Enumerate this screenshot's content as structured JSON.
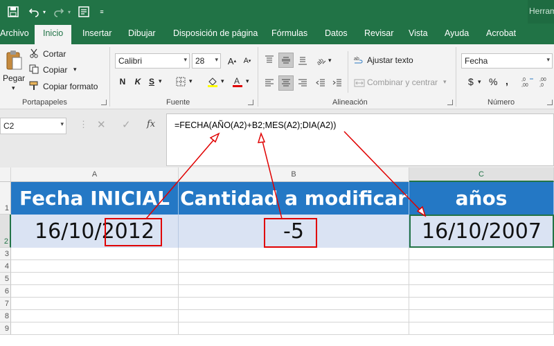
{
  "titlebar": {
    "app_title": "Herramientas"
  },
  "tabs": [
    "Archivo",
    "Inicio",
    "Insertar",
    "Dibujar",
    "Disposición de página",
    "Fórmulas",
    "Datos",
    "Revisar",
    "Vista",
    "Ayuda",
    "Acrobat"
  ],
  "ribbon": {
    "clipboard": {
      "paste_label": "Pegar",
      "cut_label": "Cortar",
      "copy_label": "Copiar",
      "format_painter_label": "Copiar formato",
      "group_label": "Portapapeles"
    },
    "font": {
      "font_name": "Calibri",
      "font_size": "28",
      "bold": "N",
      "italic": "K",
      "underline": "S",
      "group_label": "Fuente"
    },
    "alignment": {
      "wrap_label": "Ajustar texto",
      "merge_label": "Combinar y centrar",
      "group_label": "Alineación"
    },
    "number": {
      "format_value": "Fecha",
      "currency": "$",
      "percent": "%",
      "group_label": "Número"
    }
  },
  "formula_bar": {
    "name_box": "C2",
    "fx": "fx",
    "formula": "=FECHA(AÑO(A2)+B2;MES(A2);DIA(A2))"
  },
  "sheet": {
    "columns": [
      "A",
      "B",
      "C"
    ],
    "rows": [
      "1",
      "2",
      "3",
      "4",
      "5",
      "6",
      "7",
      "8",
      "9"
    ],
    "headers": [
      "Fecha INICIAL",
      "Cantidad a modificar",
      "años"
    ],
    "values": [
      "16/10/2012",
      "-5",
      "16/10/2007"
    ],
    "selected_cell": "C2"
  },
  "colors": {
    "excel_green": "#217346",
    "header_blue": "#2478c5",
    "data_fill": "#dae3f3",
    "annotation_red": "#e00000"
  }
}
